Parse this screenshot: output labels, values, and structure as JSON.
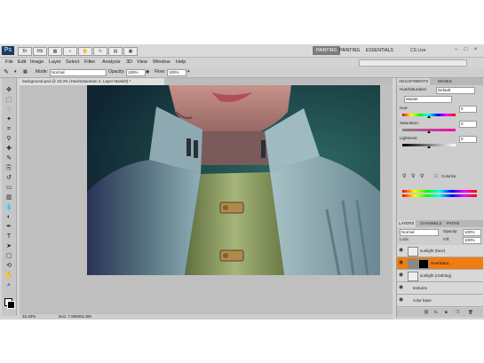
{
  "app": {
    "logo": "Ps",
    "workspaces": [
      {
        "label": "PAINTING",
        "active": true
      },
      {
        "label": "PAINTING",
        "active": false
      },
      {
        "label": "ESSENTIALS",
        "active": false
      }
    ],
    "cs_live": "CS Live"
  },
  "menu": [
    "File",
    "Edit",
    "Image",
    "Layer",
    "Select",
    "Filter",
    "Analysis",
    "3D",
    "View",
    "Window",
    "Help"
  ],
  "options": {
    "mode_label": "Mode:",
    "mode_value": "Normal",
    "opacity_label": "Opacity:",
    "opacity_value": "100%",
    "flow_label": "Flow:",
    "flow_value": "100%"
  },
  "document_tab": "background.psd @ 33.3% (Hue/Saturation 2, Layer Mask/8) *",
  "status": {
    "zoom": "33.33%",
    "doc": "Doc: 7.90M/81.9M"
  },
  "adjustments": {
    "tabs": [
      "ADJUSTMENTS",
      "MASKS"
    ],
    "title": "Hue/Saturation",
    "preset_value": "Default",
    "channel_value": "Master",
    "hue_label": "Hue:",
    "hue_value": "0",
    "saturation_label": "Saturation:",
    "saturation_value": "0",
    "lightness_label": "Lightness:",
    "lightness_value": "0",
    "colorize_label": "Colorize"
  },
  "layers": {
    "tabs": [
      "LAYERS",
      "CHANNELS",
      "PATHS"
    ],
    "blend_mode": "Normal",
    "opacity_label": "Opacity:",
    "opacity_value": "100%",
    "lock_label": "Lock:",
    "fill_label": "Fill:",
    "fill_value": "100%",
    "items": [
      {
        "name": "sunlight (face)",
        "selected": false
      },
      {
        "name": "Hue/Satur...",
        "selected": true
      },
      {
        "name": "sunlight (clothing)",
        "selected": false
      },
      {
        "name": "textures",
        "selected": false
      },
      {
        "name": "color base",
        "selected": false
      }
    ]
  },
  "colors": {
    "selected_layer": "#f07c12",
    "canvas_bg": "#1f4a4a",
    "coat": "#7d9aa5",
    "vest": "#8fa063"
  }
}
